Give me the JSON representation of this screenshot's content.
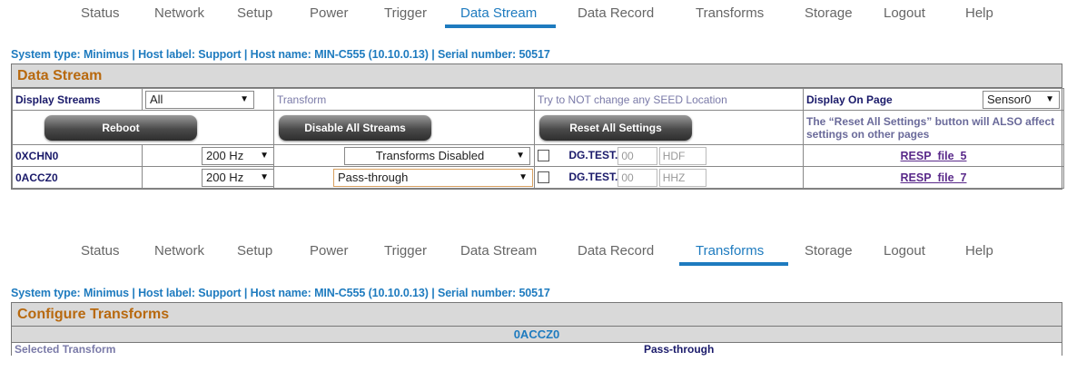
{
  "nav1": {
    "items": [
      "Status",
      "Network",
      "Setup",
      "Power",
      "Trigger",
      "Data Stream",
      "Data Record",
      "Transforms",
      "Storage",
      "Logout",
      "Help"
    ],
    "active": "Data Stream"
  },
  "sysinfo": "System type: Minimus | Host label: Support | Host name: MIN-C555 (10.10.0.13) | Serial number: 50517",
  "datastream": {
    "title": "Data Stream",
    "display_streams_label": "Display Streams",
    "display_streams_value": "All",
    "transform_label": "Transform",
    "seed_note": "Try to NOT change any SEED Location",
    "display_on_page_label": "Display On Page",
    "display_on_page_value": "Sensor0",
    "reboot_label": "Reboot",
    "disable_streams_label": "Disable All Streams",
    "reset_settings_label": "Reset All Settings",
    "reset_note": "The “Reset All Settings” button will ALSO affect settings on other pages",
    "rows": [
      {
        "name": "0XCHN0",
        "rate": "200 Hz",
        "transform": "Transforms Disabled",
        "seed_prefix": "DG.TEST.",
        "location": "00",
        "channel": "HDF",
        "resp": "RESP_file_5"
      },
      {
        "name": "0ACCZ0",
        "rate": "200 Hz",
        "transform": "Pass-through",
        "seed_prefix": "DG.TEST.",
        "location": "00",
        "channel": "HHZ",
        "resp": "RESP_file_7"
      }
    ]
  },
  "nav2": {
    "items": [
      "Status",
      "Network",
      "Setup",
      "Power",
      "Trigger",
      "Data Stream",
      "Data Record",
      "Transforms",
      "Storage",
      "Logout",
      "Help"
    ],
    "active": "Transforms"
  },
  "sysinfo2": "System type: Minimus | Host label: Support | Host name: MIN-C555 (10.10.0.13) | Serial number: 50517",
  "transforms": {
    "title": "Configure Transforms",
    "channel": "0ACCZ0",
    "selected_label": "Selected Transform",
    "selected_value": "Pass-through"
  },
  "icons": {
    "dropdown": "dropdown-arrow-icon",
    "checkbox": "checkbox-icon"
  },
  "colors": {
    "accent": "#1e7bbf",
    "title": "#b8690f",
    "header_bg": "#d9d9d9",
    "link": "#5a2a8a"
  }
}
